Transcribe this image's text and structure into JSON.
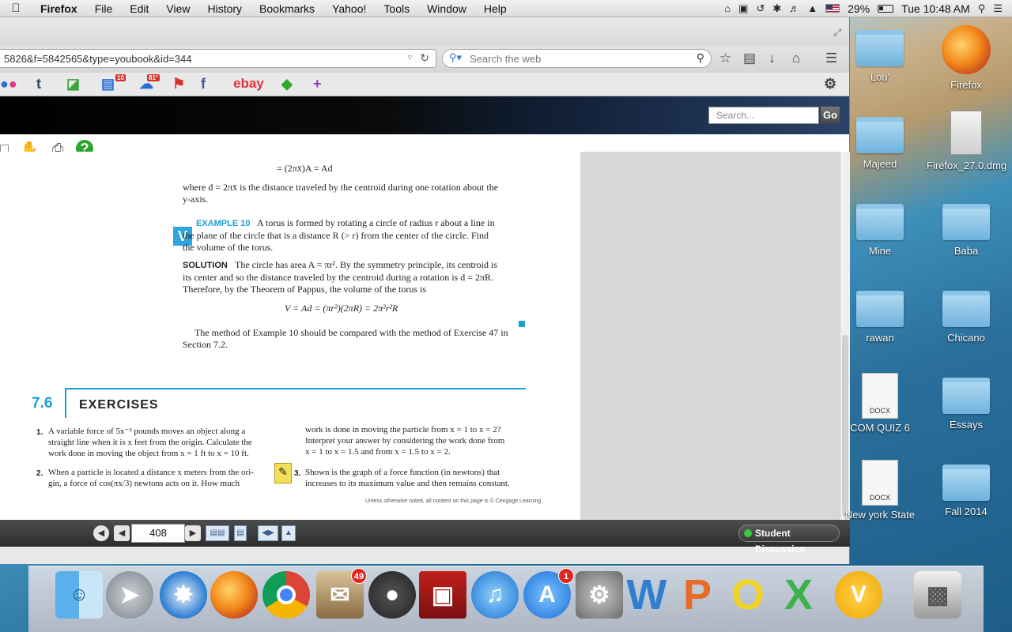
{
  "menubar": {
    "apple": "",
    "items": [
      "Firefox",
      "File",
      "Edit",
      "View",
      "History",
      "Bookmarks",
      "Yahoo!",
      "Tools",
      "Window",
      "Help"
    ],
    "battery": "29%",
    "clock": "Tue 10:48 AM"
  },
  "browser": {
    "url": "5826&f=5842565&type=youbook&id=344",
    "search_placeholder": "Search the web",
    "bookmarks": {
      "ebay": "ebay",
      "badge_news": "10",
      "badge_weather": "81°"
    },
    "site": {
      "search_placeholder": "Search...",
      "go_label": "Go"
    }
  },
  "document": {
    "partial_top": "= (2πx̄)A = Ad",
    "where_text": "where d = 2πx̄ is the distance traveled by the centroid during one rotation about the",
    "where_text2": "y-axis.",
    "v_badge": "V",
    "example_label": "EXAMPLE 10",
    "example_text1": "A torus is formed by rotating a circle of radius r about a line in",
    "example_text2": "the plane of the circle that is a distance R (> r) from the center of the circle. Find",
    "example_text3": "the volume of the torus.",
    "solution_label": "SOLUTION",
    "solution_text1": "The circle has area A = πr². By the symmetry principle, its centroid is",
    "solution_text2": "its center and so the distance traveled by the centroid during a rotation is d = 2πR.",
    "solution_text3": "Therefore, by the Theorem of Pappus, the volume of the torus is",
    "formula": "V = Ad = (πr²)(2πR) = 2π²r²R",
    "method_text1": "The method of Example 10 should be compared with the method of Exercise 47 in",
    "method_text2": "Section 7.2.",
    "section_number": "7.6",
    "section_title": "EXERCISES",
    "ex1_num": "1.",
    "ex1_l1": "A variable force of 5x⁻² pounds moves an object along a",
    "ex1_l2": "straight line when it is x feet from the origin. Calculate the",
    "ex1_l3": "work done in moving the object from x = 1 ft to x = 10 ft.",
    "ex2_num": "2.",
    "ex2_l1": "When a particle is located a distance x meters from the ori-",
    "ex2_l2": "gin, a force of cos(πx/3) newtons acts on it. How much",
    "ex2c_l1": "work is done in moving the particle from x = 1 to x = 2?",
    "ex2c_l2": "Interpret your answer by considering the work done from",
    "ex2c_l3": "x = 1 to x = 1.5 and from x = 1.5 to x = 2.",
    "ex3_num": "3.",
    "ex3_l1": "Shown is the graph of a force function (in newtons) that",
    "ex3_l2": "increases to its maximum value and then remains constant.",
    "copyright": "Unless otherwise noted, all content on this page is © Cengage Learning."
  },
  "reader": {
    "page_number": "408",
    "student_discussion": "Student Discussion"
  },
  "desktop": {
    "icons": [
      {
        "label": "Lou'",
        "type": "folder"
      },
      {
        "label": "Firefox",
        "type": "app"
      },
      {
        "label": "Majeed",
        "type": "folder"
      },
      {
        "label": "Firefox_27.0.dmg",
        "type": "dmg"
      },
      {
        "label": "Mine",
        "type": "folder"
      },
      {
        "label": "Baba",
        "type": "folder"
      },
      {
        "label": "rawan",
        "type": "folder"
      },
      {
        "label": "Chicano",
        "type": "folder"
      },
      {
        "label": "COM QUIZ 6",
        "type": "docx"
      },
      {
        "label": "Essays",
        "type": "folder"
      },
      {
        "label": "New york State",
        "type": "docx"
      },
      {
        "label": "Fall 2014",
        "type": "folder"
      }
    ],
    "docx_label": "DOCX"
  },
  "dock": {
    "mail_badge": "49",
    "appstore_badge": "1",
    "apps": [
      "Finder",
      "Launchpad",
      "Safari",
      "Firefox",
      "Chrome",
      "Mail",
      "FaceTime",
      "Photo Booth",
      "iTunes",
      "App Store",
      "System Preferences",
      "Word",
      "PowerPoint",
      "Outlook",
      "Excel",
      "Vonage",
      "Trash"
    ]
  },
  "colors": {
    "accent": "#1aa0d8",
    "badge_red": "#e0261f"
  }
}
